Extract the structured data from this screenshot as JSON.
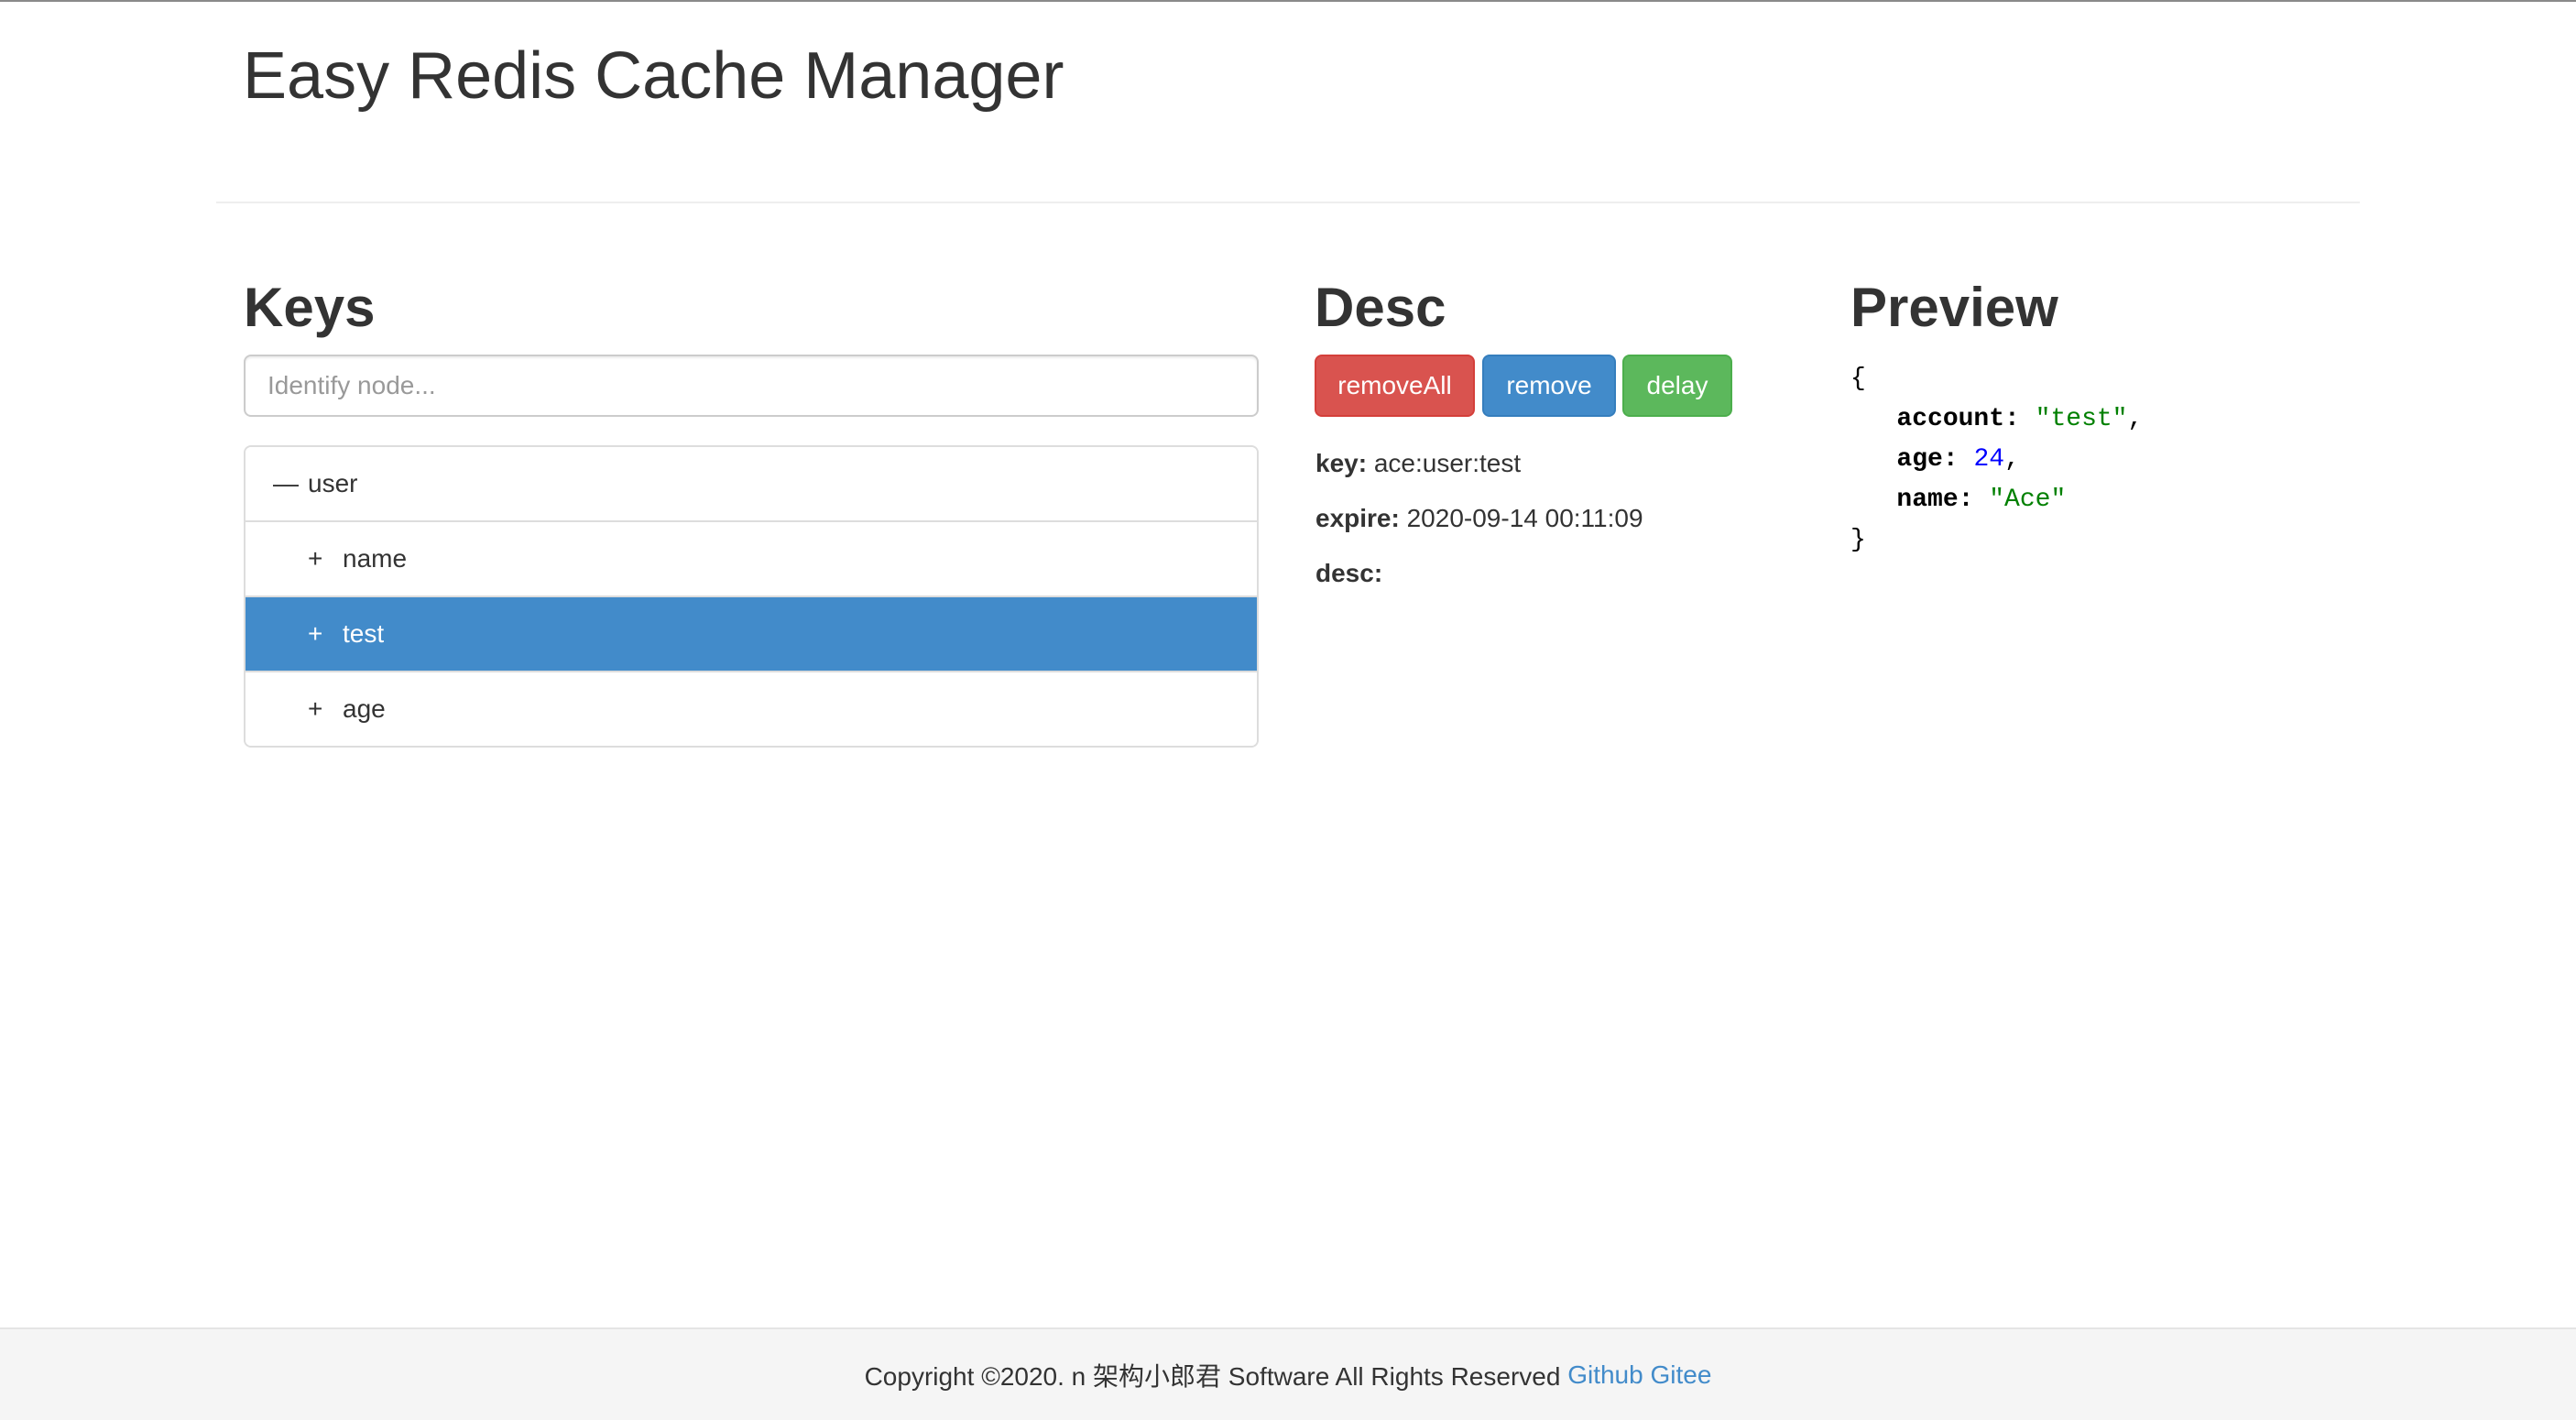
{
  "app": {
    "title": "Easy Redis Cache Manager"
  },
  "keys": {
    "heading": "Keys",
    "search_placeholder": "Identify node...",
    "tree": [
      {
        "toggle": "—",
        "label": "user",
        "level": 0,
        "selected": false
      },
      {
        "toggle": "+",
        "label": "name",
        "level": 1,
        "selected": false
      },
      {
        "toggle": "+",
        "label": "test",
        "level": 1,
        "selected": true
      },
      {
        "toggle": "+",
        "label": "age",
        "level": 1,
        "selected": false
      }
    ]
  },
  "desc": {
    "heading": "Desc",
    "buttons": {
      "remove_all": "removeAll",
      "remove": "remove",
      "delay": "delay"
    },
    "key_label": "key:",
    "key_value": "ace:user:test",
    "expire_label": "expire:",
    "expire_value": "2020-09-14 00:11:09",
    "desc_label": "desc:",
    "desc_value": ""
  },
  "preview": {
    "heading": "Preview",
    "open_brace": "{",
    "close_brace": "}",
    "entries": [
      {
        "key": "account",
        "value": "\"test\"",
        "type": "string",
        "trailing": ","
      },
      {
        "key": "age",
        "value": "24",
        "type": "number",
        "trailing": ","
      },
      {
        "key": "name",
        "value": "\"Ace\"",
        "type": "string",
        "trailing": ""
      }
    ]
  },
  "footer": {
    "copyright": "Copyright ©2020. n 架构小郎君 Software All Rights Reserved",
    "github_link": "Github",
    "gitee_link": "Gitee"
  },
  "colors": {
    "primary": "#428bca",
    "danger": "#d9534f",
    "success": "#5cb85c",
    "json_string": "#008000",
    "json_number": "#0000ff"
  }
}
